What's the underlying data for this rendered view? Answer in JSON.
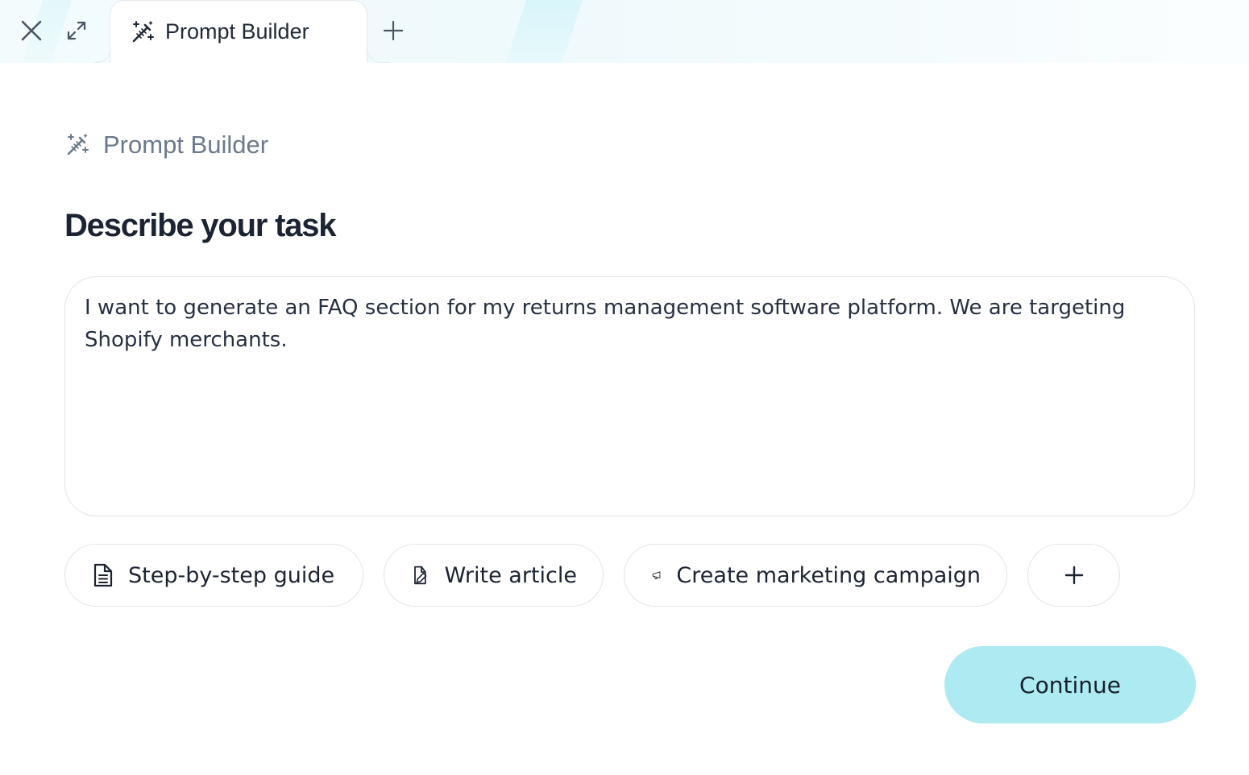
{
  "window": {
    "close_icon": "close-icon",
    "expand_icon": "expand-icon",
    "new_tab_icon": "plus-icon"
  },
  "tab": {
    "label": "Prompt Builder",
    "icon": "magic-wand-icon"
  },
  "breadcrumb": {
    "label": "Prompt Builder",
    "icon": "magic-wand-icon"
  },
  "main": {
    "heading": "Describe your task",
    "task_text": "I want to generate an FAQ section for my returns management software platform. We are targeting Shopify merchants."
  },
  "suggestions": [
    {
      "label": "Step-by-step guide",
      "icon": "document-icon"
    },
    {
      "label": "Write article",
      "icon": "pen-document-icon"
    },
    {
      "label": "Create marketing campaign",
      "icon": "megaphone-icon"
    }
  ],
  "more_suggestions_icon": "plus-icon",
  "actions": {
    "continue_label": "Continue"
  },
  "colors": {
    "accent": "#aeeaf1",
    "heading": "#1c2433",
    "muted_text": "#6b7a8c",
    "border": "#dfe3e8"
  }
}
